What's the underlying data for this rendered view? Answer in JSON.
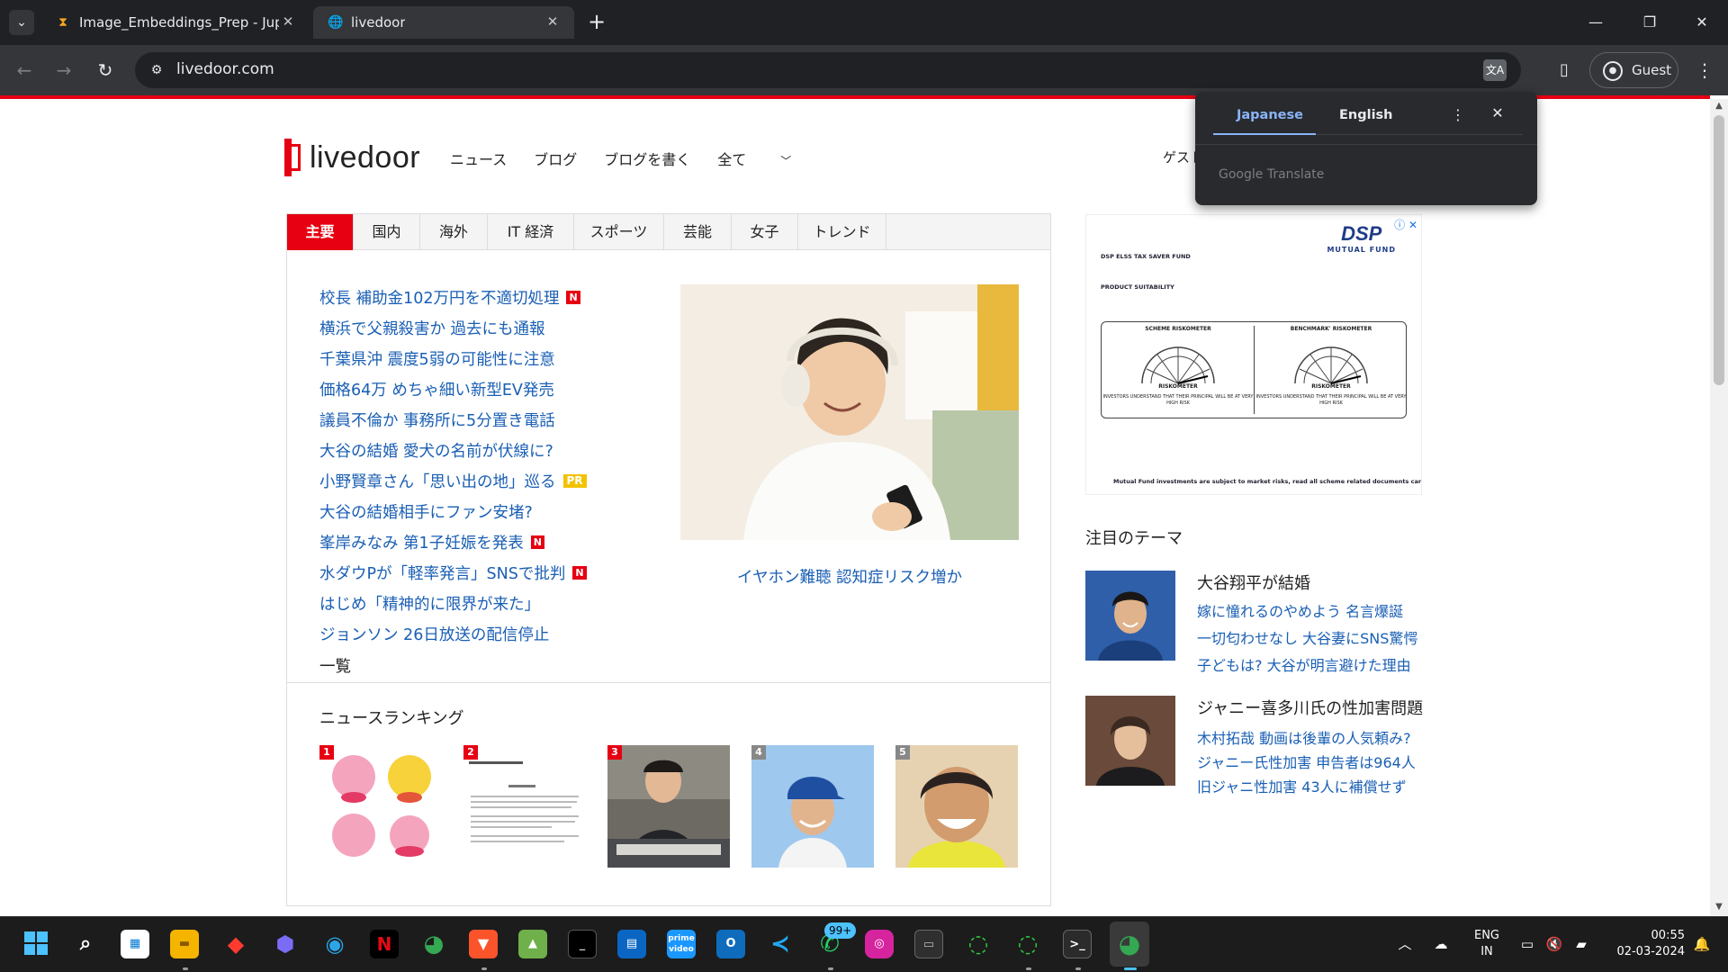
{
  "browser": {
    "tabs": [
      {
        "title": "Image_Embeddings_Prep - Jupy",
        "icon": "hourglass-icon"
      },
      {
        "title": "livedoor",
        "icon": "globe-icon"
      }
    ],
    "url": "livedoor.com",
    "profile_label": "Guest"
  },
  "translate_popup": {
    "languages": [
      "Japanese",
      "English"
    ],
    "active_language": "Japanese",
    "powered_by": "Google Translate"
  },
  "site": {
    "logo_text": "livedoor",
    "nav": [
      "ニュース",
      "ブログ",
      "ブログを書く",
      "全て"
    ],
    "guest_link": "ゲスト",
    "category_tabs": [
      "主要",
      "国内",
      "海外",
      "IT 経済",
      "スポーツ",
      "芸能",
      "女子",
      "トレンド"
    ],
    "headlines": [
      {
        "text": "校長 補助金102万円を不適切処理",
        "badge": "N"
      },
      {
        "text": "横浜で父親殺害か 過去にも通報",
        "badge": ""
      },
      {
        "text": "千葉県沖 震度5弱の可能性に注意",
        "badge": ""
      },
      {
        "text": "価格64万 めちゃ細い新型EV発売",
        "badge": ""
      },
      {
        "text": "議員不倫か 事務所に5分置き電話",
        "badge": ""
      },
      {
        "text": "大谷の結婚 愛犬の名前が伏線に?",
        "badge": ""
      },
      {
        "text": "小野賢章さん「思い出の地」巡る",
        "badge": "PR"
      },
      {
        "text": "大谷の結婚相手にファン安堵?",
        "badge": ""
      },
      {
        "text": "峯岸みなみ 第1子妊娠を発表",
        "badge": "N"
      },
      {
        "text": "水ダウPが「軽率発言」SNSで批判",
        "badge": "N"
      },
      {
        "text": "はじめ「精神的に限界が来た」",
        "badge": ""
      },
      {
        "text": "ジョンソン 26日放送の配信停止",
        "badge": ""
      }
    ],
    "more_link": "一覧",
    "featured_caption": "イヤホン難聴 認知症リスク増か",
    "ranking_title": "ニュースランキング",
    "ranking": [
      {
        "rank": "1"
      },
      {
        "rank": "2"
      },
      {
        "rank": "3"
      },
      {
        "rank": "4"
      },
      {
        "rank": "5"
      }
    ],
    "ad": {
      "brand": "DSP",
      "brand_sub": "MUTUAL FUND",
      "heading1": "DSP ELSS TAX SAVER FUND",
      "heading2": "PRODUCT SUITABILITY",
      "scheme_label": "SCHEME RISKOMETER",
      "benchmark_label": "BENCHMARK' RISKOMETER",
      "riskometer_caption": "RISKOMETER",
      "scheme_note": "INVESTORS UNDERSTAND THAT THEIR PRINCIPAL WILL BE AT VERY HIGH RISK",
      "benchmark_note": "INVESTORS UNDERSTAND THAT THEIR PRINCIPAL WILL BE AT VERY HIGH RISK",
      "footer": "Mutual Fund investments are subject to market risks, read all scheme related documents carefully."
    },
    "themes_title": "注目のテーマ",
    "themes": [
      {
        "heading": "大谷翔平が結婚",
        "links": [
          "嫁に憧れるのやめよう 名言爆誕",
          "一切匂わせなし 大谷妻にSNS驚愕",
          "子どもは? 大谷が明言避けた理由"
        ]
      },
      {
        "heading": "ジャニー喜多川氏の性加害問題",
        "links": [
          "木村拓哉 動画は後輩の人気頼み?",
          "ジャニー氏性加害 申告者は964人",
          "旧ジャニ性加害 43人に補償せず"
        ]
      }
    ]
  },
  "taskbar": {
    "whatsapp_badge": "99+",
    "language": [
      "ENG",
      "IN"
    ],
    "time": "00:55",
    "date": "02-03-2024"
  },
  "colors": {
    "brand_red": "#e60012",
    "link_blue": "#1a5fb4",
    "chrome_dark": "#202124",
    "translate_blue": "#8ab4f8"
  }
}
